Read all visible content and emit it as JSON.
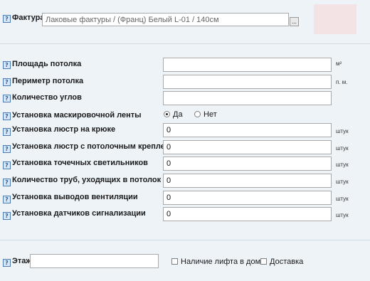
{
  "invoice": {
    "label": "Фактура",
    "value": "Лаковые фактуры / (Франц) Белый L-01 / 140см",
    "browse_label": "..."
  },
  "params": [
    {
      "label": "Площадь потолка",
      "value": "",
      "unit": "м²"
    },
    {
      "label": "Периметр потолка",
      "value": "",
      "unit": "п. м."
    },
    {
      "label": "Количество углов",
      "value": "",
      "unit": ""
    }
  ],
  "tape": {
    "label": "Установка маскировочной ленты",
    "options": [
      {
        "label": "Да",
        "checked": true
      },
      {
        "label": "Нет",
        "checked": false
      }
    ]
  },
  "installs": [
    {
      "label": "Установка люстр на крюке",
      "value": "0",
      "unit": "штук"
    },
    {
      "label": "Установка люстр с потолочным креплением",
      "value": "0",
      "unit": "штук"
    },
    {
      "label": "Установка точечных светильников",
      "value": "0",
      "unit": "штук"
    },
    {
      "label": "Количество труб, уходящих в потолок",
      "value": "0",
      "unit": "штук"
    },
    {
      "label": "Установка выводов вентиляции",
      "value": "0",
      "unit": "штук"
    },
    {
      "label": "Установка датчиков сигнализации",
      "value": "0",
      "unit": "штук"
    }
  ],
  "floor": {
    "label": "Этаж",
    "value": "",
    "elevator_label": "Наличие лифта в доме",
    "elevator_checked": false,
    "delivery_label": "Доставка",
    "delivery_checked": false
  },
  "help_icon": "question-icon",
  "colors": {
    "background": "#eef3f8",
    "preview": "#f3e3e5",
    "help_border": "#4a79b0"
  }
}
